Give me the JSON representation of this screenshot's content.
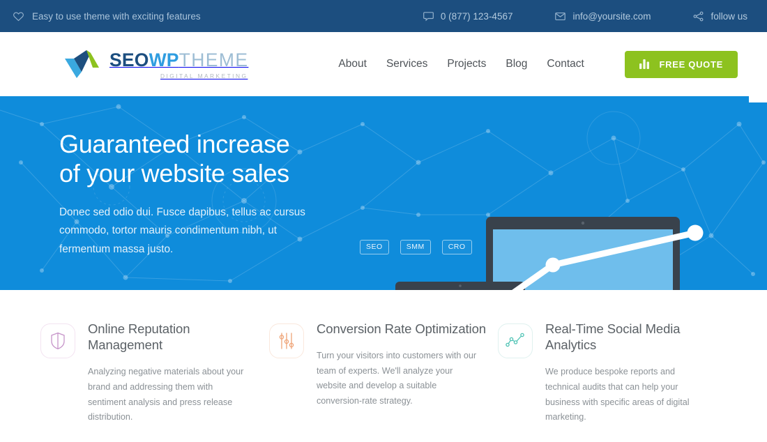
{
  "topbar": {
    "tagline": "Easy to use theme with exciting features",
    "tagline_icon": "heart-icon",
    "phone": "0 (877) 123-4567",
    "phone_icon": "chat-bubble-icon",
    "email": "info@yoursite.com",
    "email_icon": "envelope-icon",
    "social": "follow us",
    "social_icon": "share-icon",
    "bg_color": "#1c4e7f",
    "text_color": "#b3cade"
  },
  "header": {
    "logo": {
      "part1": "SEO",
      "part2": "WP",
      "part3": "THEME",
      "tagline": "DIGITAL MARKETING",
      "mark_icon": "checkmark-arrow-logo-icon",
      "color_part1": "#1c4e7f",
      "color_part2": "#2f9de0",
      "color_part3": "#9dbdd4"
    },
    "nav": [
      {
        "label": "About"
      },
      {
        "label": "Services"
      },
      {
        "label": "Projects"
      },
      {
        "label": "Blog"
      },
      {
        "label": "Contact"
      }
    ],
    "cta": {
      "label": "FREE QUOTE",
      "icon": "bar-chart-icon",
      "bg_color": "#8dc21f"
    }
  },
  "hero": {
    "bg_color": "#0f8cdb",
    "title_line1": "Guaranteed increase",
    "title_line2": "of your website sales",
    "description": "Donec sed odio dui. Fusce dapibus, tellus ac cursus commodo, tortor mauris condimentum nibh, ut fermentum massa justo.",
    "badges": [
      {
        "label": "SEO"
      },
      {
        "label": "SMM"
      },
      {
        "label": "CRO"
      }
    ],
    "illustration": {
      "monitor_icon": "desktop-monitor-icon",
      "laptop_icon": "laptop-icon",
      "growth_line_icon": "growth-line-chart-icon",
      "monitor_screen_color": "#6fbeec",
      "laptop_screen_color": "#8dc21f",
      "device_bezel_color": "#39424c"
    }
  },
  "features": [
    {
      "icon": "shield-icon",
      "icon_color": "#c694c9",
      "title": "Online Reputation Management",
      "text": "Analyzing negative materials about your brand and addressing them with sentiment analysis and press release distribution."
    },
    {
      "icon": "sliders-icon",
      "icon_color": "#efa376",
      "title": "Conversion Rate Optimization",
      "text": "Turn your visitors into customers with our team of experts. We'll analyze your website and develop a suitable conversion-rate strategy."
    },
    {
      "icon": "line-chart-icon",
      "icon_color": "#4ec3b4",
      "title": "Real-Time Social Media Analytics",
      "text": "We produce bespoke reports and technical audits that can help your business with specific areas of digital marketing."
    }
  ]
}
